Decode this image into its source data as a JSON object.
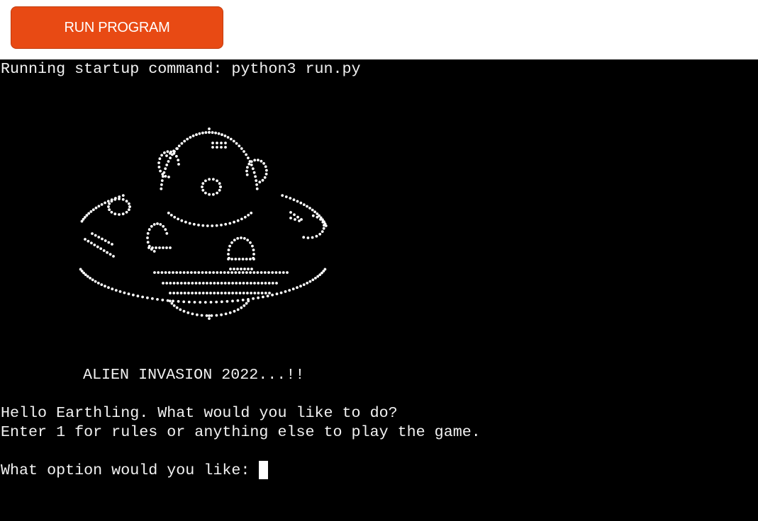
{
  "header": {
    "run_button_label": "RUN PROGRAM",
    "accent_color": "#e84a14"
  },
  "terminal": {
    "background": "#000000",
    "startup_line": "Running startup command: python3 run.py",
    "art_icon": "ufo-ascii-art",
    "title_line": "ALIEN INVASION 2022...!!",
    "greeting_line": "Hello Earthling. What would you like to do?",
    "instruction_line": "Enter 1 for rules or anything else to play the game.",
    "prompt_line": "What option would you like: "
  }
}
